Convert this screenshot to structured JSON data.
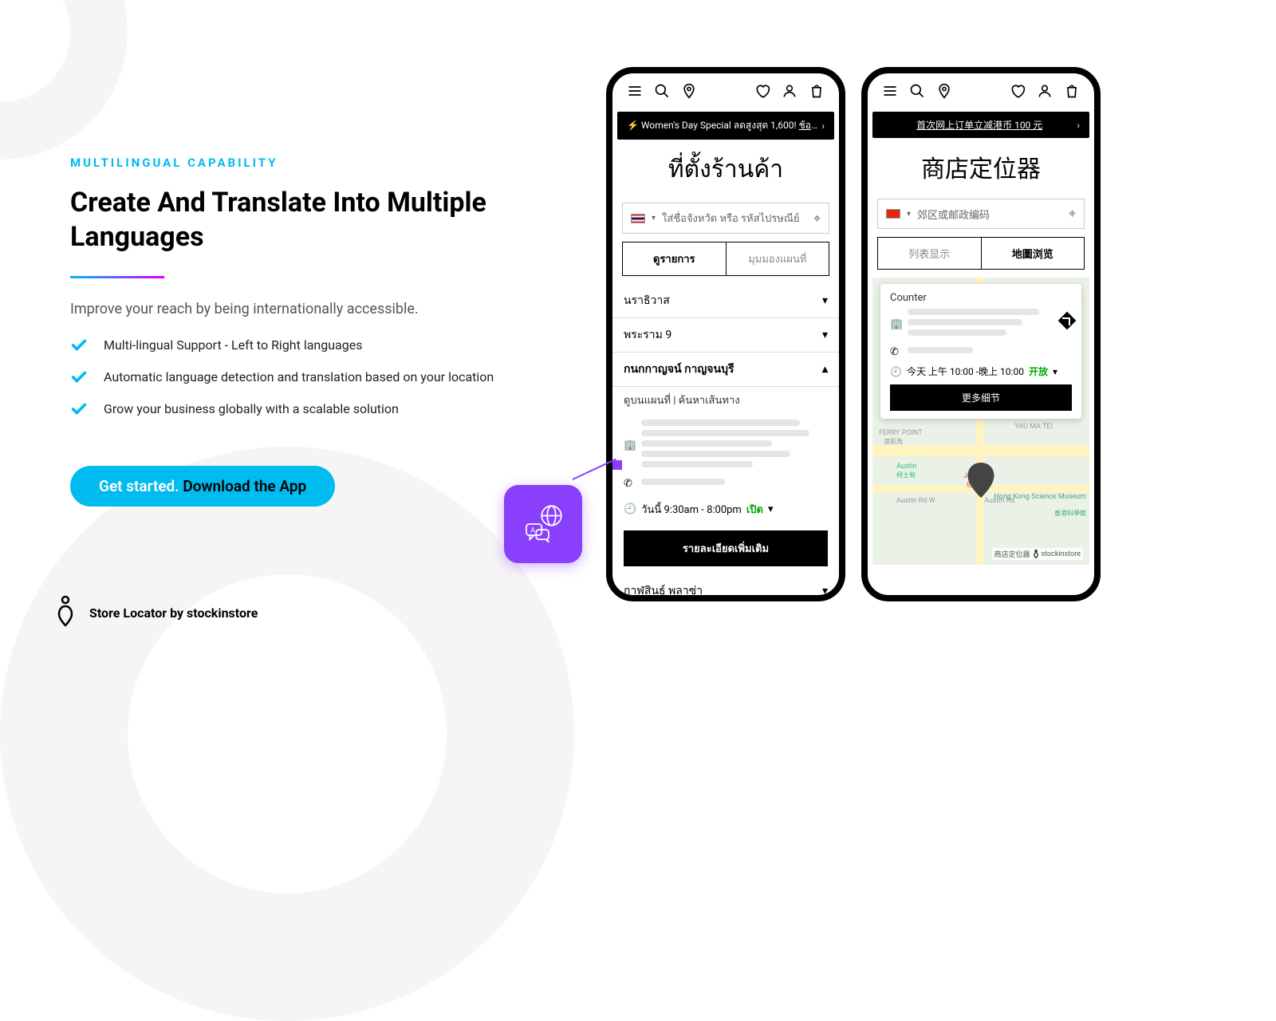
{
  "left": {
    "eyebrow": "MULTILINGUAL CAPABILITY",
    "title": "Create And Translate Into Multiple Languages",
    "desc": "Improve your reach by being internationally accessible.",
    "bullets": [
      "Multi-lingual Support - Left to Right languages",
      "Automatic language detection and translation based on your location",
      "Grow your business globally with a scalable solution"
    ],
    "cta_a": "Get started.",
    "cta_b": " Download the App"
  },
  "footer": "Store Locator by stockinstore",
  "phone1": {
    "banner_lead": "⚡ Women's Day Special ลดสูงสุด 1,600!",
    "banner_link": "ช้อปเลย",
    "heading": "ที่ตั้งร้านค้า",
    "search_placeholder": "ใส่ชื่อจังหวัด หรือ รหัสไปรษณีย์",
    "tabs": [
      "ดูรายการ",
      "มุมมองแผนที่"
    ],
    "items": [
      "นราธิวาส",
      "พระราม 9",
      "กนกกาญจน์ กาญจนบุรี",
      "กาฬสินธุ์ พลาซ่า"
    ],
    "subitem": "ดูบนแผนที่  |  ค้นหาเส้นทาง",
    "hours_label": "วันนี้ 9:30am - 8:00pm",
    "hours_status": "เปิด",
    "more": "รายละเอียดเพิ่มเติม"
  },
  "phone2": {
    "banner": "首次网上订单立减港币 100 元",
    "heading": "商店定位器",
    "search_placeholder": "郊区或邮政编码",
    "tabs": [
      "列表显示",
      "地圖浏览"
    ],
    "card_title": "Counter",
    "card_hours": "今天 上午 10:00 -晚上 10:00",
    "card_status": "开放",
    "card_more": "更多细节",
    "attrib": "商店定位器",
    "attrib_brand": "stockinstore",
    "map_labels": {
      "ferry": "FERRY POINT",
      "ferry_cn": "渡船角",
      "ymt": "YAU MA TEI",
      "austin": "Austin",
      "austin_cn": "柯士甸",
      "austin_rd": "Austin Rd W",
      "austin_rd2": "Austin Rd",
      "jordan": "Jordan",
      "jordan_cn": "佐敦",
      "hksm": "Hong Kong Science Museum",
      "hksm_cn": "香港科學館"
    }
  }
}
